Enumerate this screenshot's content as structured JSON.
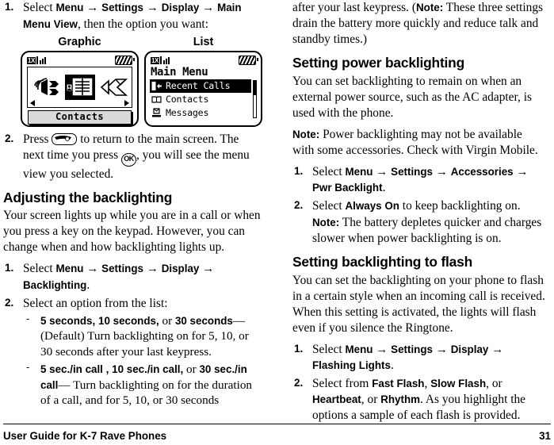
{
  "footer": {
    "title": "User Guide for K-7 Rave Phones",
    "page_number": "31"
  },
  "left_column": {
    "step1": {
      "number": "1.",
      "text_before": "Select",
      "path": [
        "Menu",
        "Settings",
        "Display",
        "Main Menu View"
      ],
      "text_after": ", then the option you want:"
    },
    "figures": {
      "graphic": {
        "caption": "Graphic",
        "status": {
          "network": "1X",
          "signal": "signal-bars",
          "battery": "battery"
        },
        "icons": [
          "ringer-icon",
          "contacts-icon",
          "messages-icon"
        ],
        "selected_index": 1,
        "softkey_label": "Contacts",
        "left_arrow": "◀",
        "right_arrow": "▶"
      },
      "list": {
        "caption": "List",
        "status": {
          "network": "1X",
          "signal": "signal-bars",
          "battery": "battery"
        },
        "title": "Main Menu",
        "rows": [
          {
            "label": "Recent Calls",
            "icon": "recent-calls-icon",
            "selected": true
          },
          {
            "label": "Contacts",
            "icon": "contacts-book-icon",
            "selected": false
          },
          {
            "label": "Messages",
            "icon": "messages-icon",
            "selected": false
          }
        ]
      }
    },
    "step2": {
      "number": "2.",
      "part1": "Press",
      "key_end": "end-key",
      "part2": "to return to the main screen. The next time you press",
      "key_ok": "OK",
      "part3": ", you will see the menu view you selected."
    },
    "section_heading": "Adjusting the backlighting",
    "intro": "Your screen lights up while you are in a call or when you press a key on the keypad. However, you can change when and how backlighting lights up.",
    "step3": {
      "number": "1.",
      "text_before": "Select",
      "path": [
        "Menu",
        "Settings",
        "Display",
        "Backlighting"
      ],
      "text_after": "."
    },
    "step4": {
      "number": "2.",
      "text": "Select an option from the list:"
    },
    "bullets": [
      {
        "dash": "-",
        "bold_parts": [
          "5 seconds,",
          "10 seconds,",
          "30 seconds"
        ],
        "text": "(Default)  Turn backlighting on for 5, 10, or 30 seconds after your last keypress."
      },
      {
        "dash": "-",
        "bold_parts": [
          "5 sec./in call ,",
          "10 sec./in call,",
          "30 sec./in call"
        ],
        "text": "Turn backlighting on for the duration of a call, and for 5, 10, or 30 seconds"
      }
    ]
  },
  "right_column": {
    "continued_text": "after your last keypress. (",
    "continued_note_label": "Note:",
    "continued_note_text": "These three settings drain the battery more quickly and reduce talk and standby times.)",
    "section_power": {
      "heading": "Setting power backlighting",
      "body": "You can set backlighting to remain on when an external power source, such as the AC adapter, is used with the phone.",
      "note_label": "Note:",
      "note_text": "Power backlighting may not be available with some accessories. Check with Virgin Mobile.",
      "step1": {
        "number": "1.",
        "text_before": "Select",
        "path": [
          "Menu",
          "Settings",
          "Accessories",
          "Pwr Backlight"
        ],
        "text_after": "."
      },
      "step2": {
        "number": "2.",
        "text_before": "Select",
        "bold": "Always On",
        "text_after": "to keep backlighting on.",
        "note_label": "Note:",
        "note_text": "The battery depletes quicker and charges slower when power backlighting is on."
      }
    },
    "section_flash": {
      "heading": "Setting backlighting to flash",
      "body": "You can set the backlighting on your phone to flash in a certain style when an incoming call is received. When this setting is activated, the lights will flash even if you silence the Ringtone.",
      "step1": {
        "number": "1.",
        "text_before": "Select",
        "path": [
          "Menu",
          "Settings",
          "Display",
          "Flashing Lights"
        ],
        "text_after": "."
      },
      "step2": {
        "number": "2.",
        "text_before": "Select from",
        "options": [
          "Fast Flash",
          "Slow Flash",
          "Heartbeat",
          "Rhythm"
        ],
        "text_after": ". As you highlight the options a sample of each flash is provided."
      }
    }
  },
  "symbols": {
    "arrow": "→"
  }
}
